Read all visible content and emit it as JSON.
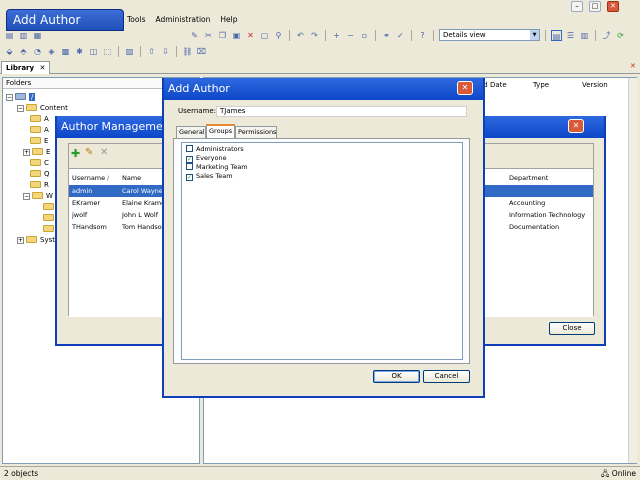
{
  "app": {
    "title": "Add Author",
    "menu": [
      "Tools",
      "Administration",
      "Help"
    ],
    "toolbar": {
      "view_select": "Details view"
    },
    "library_tab": "Library",
    "library_tab_close": "✕",
    "folders_header": "Folders",
    "tree": {
      "root": "/",
      "content": "Content",
      "children": [
        "A",
        "A",
        "E",
        "E",
        "C",
        "Q",
        "R",
        "W"
      ],
      "system": "Syste"
    },
    "list_columns": [
      "ed Date",
      "Type",
      "Version"
    ],
    "status_left": "2 objects",
    "status_right": "Online"
  },
  "author_management": {
    "title": "Author Management",
    "columns": {
      "username": "Username",
      "name": "Name",
      "department": "Department",
      "sort_mark": "/"
    },
    "rows": [
      {
        "username": "admin",
        "name": "Carol  Wayne",
        "department": "",
        "selected": true
      },
      {
        "username": "EKramer",
        "name": "Elaine  Kramer",
        "department": "Accounting",
        "selected": false
      },
      {
        "username": "jwolf",
        "name": "John L Wolf",
        "department": "Information Technology",
        "selected": false
      },
      {
        "username": "THandsom",
        "name": "Tom  Handsom",
        "department": "Documentation",
        "selected": false
      }
    ],
    "close_button": "Close"
  },
  "add_author": {
    "title": "Add Author",
    "username_label": "Username:",
    "username_value": "TJames",
    "tabs": [
      "General",
      "Groups",
      "Permissions"
    ],
    "active_tab": "Groups",
    "groups": [
      {
        "label": "Administrators",
        "checked": false
      },
      {
        "label": "Everyone",
        "checked": true
      },
      {
        "label": "Marketing Team",
        "checked": false
      },
      {
        "label": "Sales Team",
        "checked": true
      }
    ],
    "ok_button": "OK",
    "cancel_button": "Cancel"
  },
  "colors": {
    "title_bar": "#0c47c8",
    "selection": "#316ac5",
    "close_red": "#d85a3a"
  }
}
